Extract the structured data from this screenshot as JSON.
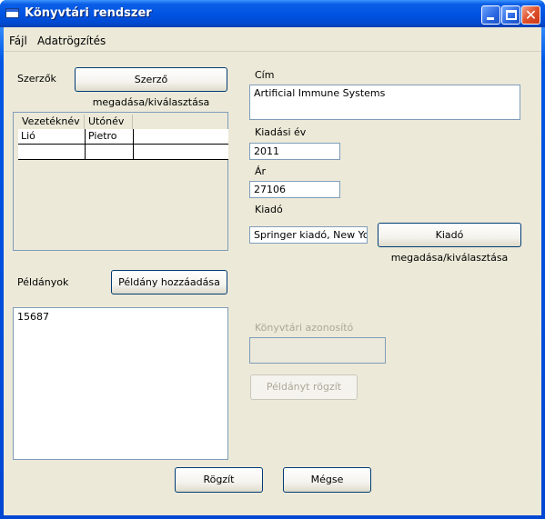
{
  "window": {
    "title": "Könyvtári rendszer",
    "minimize": "minimize",
    "maximize": "maximize",
    "close": "✕"
  },
  "menu": {
    "items": [
      {
        "label": "Fájl"
      },
      {
        "label": "Adatrögzítés"
      }
    ]
  },
  "authors": {
    "label": "Szerzők",
    "button": "Szerző megadása/kiválasztása",
    "columns": [
      "Vezetéknév",
      "Utónév"
    ],
    "rows": [
      {
        "last": "Lió",
        "first": "Pietro"
      },
      {
        "last": "",
        "first": ""
      }
    ]
  },
  "book": {
    "title_label": "Cím",
    "title_value": "Artificial Immune Systems",
    "year_label": "Kiadási év",
    "year_value": "2011",
    "price_label": "Ár",
    "price_value": "27106",
    "publisher_label": "Kiadó",
    "publisher_value": "Springer kiadó, New York",
    "publisher_button": "Kiadó megadása/kiválasztása"
  },
  "copies": {
    "label": "Példányok",
    "add_button": "Példány hozzáadása",
    "items": [
      "15687"
    ],
    "library_id_label": "Könyvtári azonosító",
    "library_id_value": "",
    "save_copy_button": "Példányt rögzít"
  },
  "footer": {
    "save_button": "Rögzít",
    "cancel_button": "Mégse"
  },
  "colors": {
    "titlebar": "#0054e3",
    "client": "#ece9d8",
    "border": "#7f9db9",
    "button_border": "#003c74",
    "disabled_text": "#aca899"
  }
}
